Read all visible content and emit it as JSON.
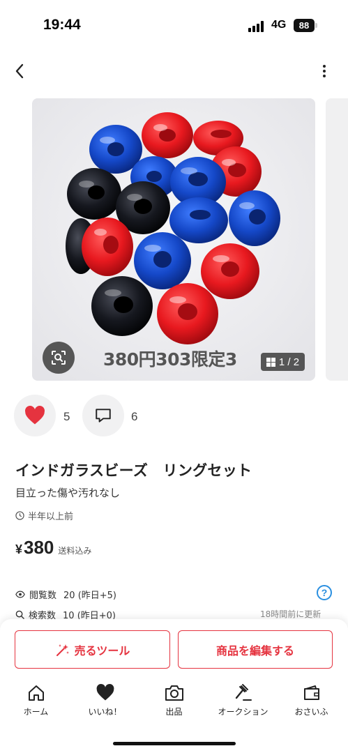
{
  "status_bar": {
    "time": "19:44",
    "network": "4G",
    "battery": "88"
  },
  "nav": {
    "back_icon": "chevron-left-icon",
    "more_icon": "more-vertical-icon"
  },
  "photo": {
    "caption": "380円303限定3",
    "page_indicator": "1 / 2",
    "scan_icon": "image-search-icon"
  },
  "social": {
    "likes": "5",
    "comments": "6"
  },
  "product": {
    "title": "インドガラスビーズ　リングセット",
    "condition": "目立った傷や汚れなし",
    "posted": "半年以上前",
    "currency": "¥",
    "price": "380",
    "shipping": "送料込み"
  },
  "stats": {
    "views_label": "閲覧数",
    "views_value": "20 (昨日+5)",
    "search_label": "検索数",
    "search_value": "10 (昨日+0)",
    "help": "?",
    "updated": "18時間前に更新"
  },
  "actions": {
    "sell_tool": "売るツール",
    "edit_item": "商品を編集する"
  },
  "tabbar": {
    "items": [
      {
        "label": "ホーム",
        "icon": "home-icon"
      },
      {
        "label": "いいね！",
        "icon": "heart-icon"
      },
      {
        "label": "出品",
        "icon": "camera-icon"
      },
      {
        "label": "オークション",
        "icon": "gavel-icon"
      },
      {
        "label": "おさいふ",
        "icon": "wallet-icon"
      }
    ]
  },
  "colors": {
    "accent": "#e5333f",
    "link": "#2a8fe0",
    "bead_red": "#e8191f",
    "bead_blue": "#1548c8",
    "bead_black": "#16181f"
  }
}
